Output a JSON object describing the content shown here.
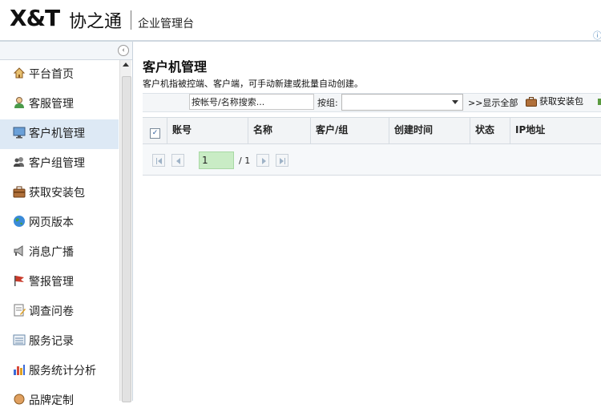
{
  "header": {
    "logo_latin": "X&T",
    "logo_cn": "协之通",
    "subtitle": "企业管理台"
  },
  "sidebar": {
    "items": [
      {
        "label": "平台首页",
        "icon": "home-icon"
      },
      {
        "label": "客服管理",
        "icon": "user-icon"
      },
      {
        "label": "客户机管理",
        "icon": "monitor-icon",
        "active": true
      },
      {
        "label": "客户组管理",
        "icon": "group-icon"
      },
      {
        "label": "获取安装包",
        "icon": "package-icon"
      },
      {
        "label": "网页版本",
        "icon": "globe-icon"
      },
      {
        "label": "消息广播",
        "icon": "megaphone-icon"
      },
      {
        "label": "警报管理",
        "icon": "flag-icon"
      },
      {
        "label": "调查问卷",
        "icon": "survey-icon"
      },
      {
        "label": "服务记录",
        "icon": "list-icon"
      },
      {
        "label": "服务统计分析",
        "icon": "bar-chart-icon"
      },
      {
        "label": "品牌定制",
        "icon": "brand-icon"
      }
    ]
  },
  "main": {
    "title": "客户机管理",
    "description": "客户机指被控端、客户端，可手动新建或批量自动创建。",
    "toolbar": {
      "search_value": "按帐号/名称搜索...",
      "group_label": "按组:",
      "group_value": "",
      "show_all": ">>显示全部",
      "get_package": "获取安装包"
    },
    "table": {
      "columns": [
        "账号",
        "名称",
        "客户/组",
        "创建时间",
        "状态",
        "IP地址"
      ]
    },
    "pager": {
      "current_page": "1",
      "total": "/ 1"
    }
  },
  "colors": {
    "active_item_bg": "#dde9f5",
    "page_input_bg": "#c9ecc5"
  }
}
